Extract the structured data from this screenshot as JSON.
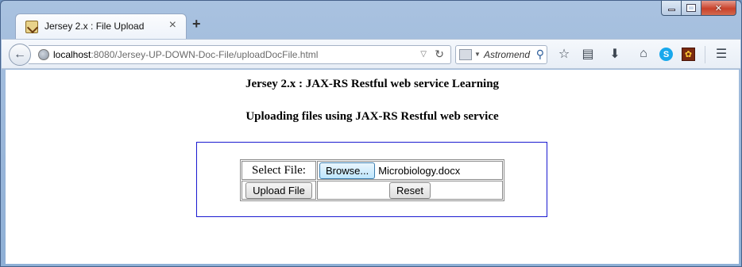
{
  "browser": {
    "tab": {
      "title": "Jersey 2.x : File Upload",
      "close": "×"
    },
    "new_tab": "+",
    "url": {
      "host": "localhost",
      "rest": ":8080/Jersey-UP-DOWN-Doc-File/uploadDocFile.html"
    },
    "search": {
      "placeholder": "Astromend"
    },
    "toolbar_icons": [
      "bookmark-star-icon",
      "reading-list-icon",
      "downloads-icon",
      "home-icon",
      "skype-icon",
      "addon-icon",
      "menu-icon"
    ]
  },
  "page": {
    "heading1": "Jersey 2.x : JAX-RS Restful web service Learning",
    "heading2": "Uploading files using JAX-RS Restful web service",
    "form": {
      "select_label": "Select File:",
      "browse_label": "Browse...",
      "selected_file": "Microbiology.docx",
      "upload_label": "Upload File",
      "reset_label": "Reset"
    }
  },
  "colors": {
    "form_border": "#1a1ad0",
    "window_frame": "#98b5d8"
  }
}
